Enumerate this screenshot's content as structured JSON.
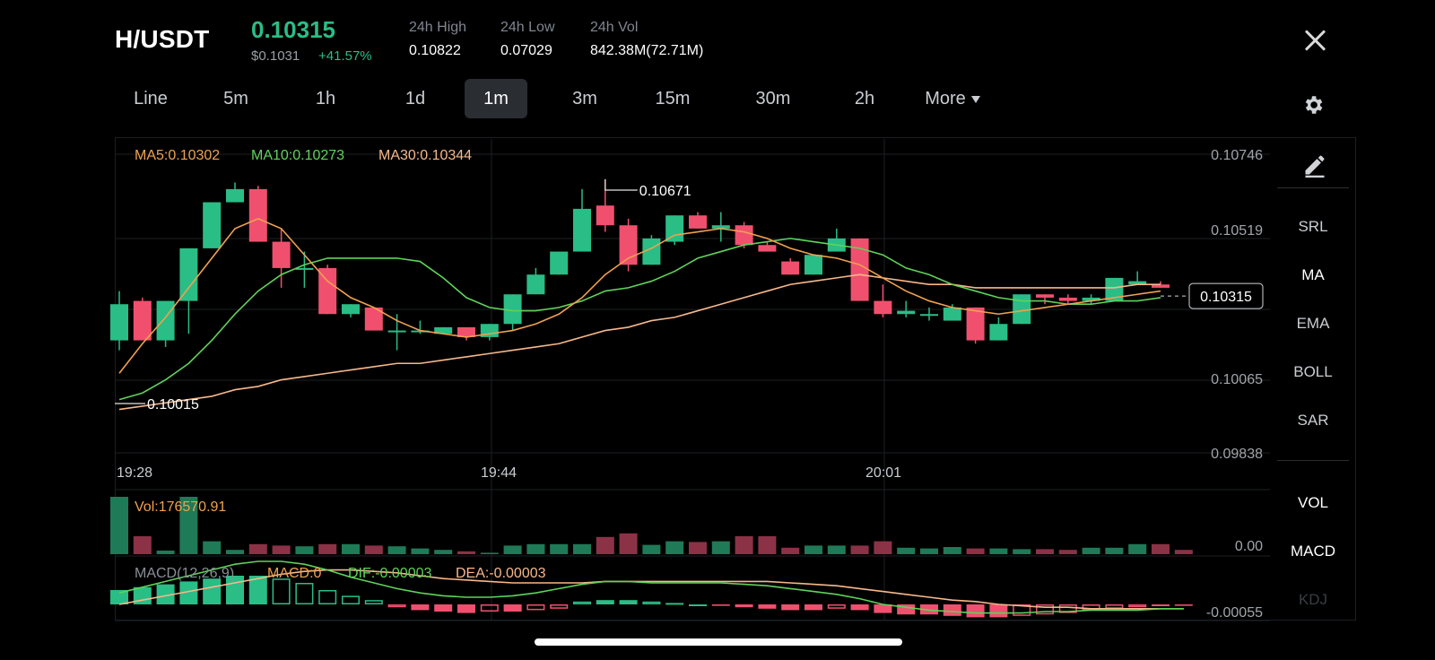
{
  "header": {
    "pair": "H/USDT",
    "price": "0.10315",
    "usd_price": "$0.1031",
    "change": "+41.57%",
    "stats": [
      {
        "label": "24h High",
        "value": "0.10822"
      },
      {
        "label": "24h Low",
        "value": "0.07029"
      },
      {
        "label": "24h Vol",
        "value": "842.38M(72.71M)"
      }
    ]
  },
  "tabs": [
    "Line",
    "5m",
    "1h",
    "1d",
    "1m",
    "3m",
    "15m",
    "30m",
    "2h",
    "More"
  ],
  "active_tab": "1m",
  "side_panel": [
    "SRL",
    "MA",
    "EMA",
    "BOLL",
    "SAR",
    "VOL",
    "MACD",
    "KDJ"
  ],
  "side_active": [
    "MA",
    "VOL",
    "MACD"
  ],
  "icons": {
    "close": "close-icon",
    "settings": "gear-icon",
    "draw": "pencil-icon",
    "more": "caret-down-icon"
  },
  "colors": {
    "up": "#2bbd86",
    "down": "#f0506e",
    "ma5": "#f0a150",
    "ma10": "#5fd35a",
    "ma30": "#f7b88a",
    "dif": "#5fd35a",
    "dea": "#f7b88a"
  },
  "chart_data": [
    {
      "type": "candlestick",
      "title": "",
      "legend": [
        {
          "label": "MA5:0.10302",
          "color": "#f0a150"
        },
        {
          "label": "MA10:0.10273",
          "color": "#5fd35a"
        },
        {
          "label": "MA30:0.10344",
          "color": "#f7b88a"
        }
      ],
      "y_ticks": [
        "0.10746",
        "0.10519",
        "0.10065",
        "0.09838"
      ],
      "ylim": [
        0.0977,
        0.1081
      ],
      "x_ticks": [
        {
          "label": "19:28",
          "index": 0
        },
        {
          "label": "19:44",
          "index": 16
        },
        {
          "label": "20:01",
          "index": 33
        }
      ],
      "current_price": "0.10315",
      "annotations": [
        {
          "label": "0.10671",
          "index": 21
        },
        {
          "label": "0.10015",
          "index": 0
        }
      ],
      "candles": [
        [
          0.1018,
          0.1029,
          0.1033,
          0.1015
        ],
        [
          0.103,
          0.1018,
          0.1031,
          0.1018
        ],
        [
          0.1018,
          0.103,
          0.103,
          0.1016
        ],
        [
          0.103,
          0.1046,
          0.1046,
          0.102
        ],
        [
          0.1046,
          0.106,
          0.106,
          0.1046
        ],
        [
          0.106,
          0.1064,
          0.1066,
          0.106
        ],
        [
          0.1064,
          0.1048,
          0.1065,
          0.1048
        ],
        [
          0.1048,
          0.104,
          0.1052,
          0.1034
        ],
        [
          0.104,
          0.104,
          0.1045,
          0.1034
        ],
        [
          0.104,
          0.1026,
          0.1041,
          0.1026
        ],
        [
          0.1026,
          0.1029,
          0.1029,
          0.1025
        ],
        [
          0.1028,
          0.1021,
          0.1028,
          0.1021
        ],
        [
          0.1021,
          0.1021,
          0.1026,
          0.1015
        ],
        [
          0.1021,
          0.1021,
          0.1024,
          0.102
        ],
        [
          0.102,
          0.1022,
          0.1022,
          0.102
        ],
        [
          0.1022,
          0.1019,
          0.1022,
          0.1018
        ],
        [
          0.1019,
          0.1023,
          0.1023,
          0.1018
        ],
        [
          0.1023,
          0.1032,
          0.1032,
          0.1021
        ],
        [
          0.1032,
          0.1038,
          0.104,
          0.1032
        ],
        [
          0.1038,
          0.1045,
          0.1045,
          0.1038
        ],
        [
          0.1045,
          0.1058,
          0.1064,
          0.1045
        ],
        [
          0.1059,
          0.1053,
          0.1067,
          0.1051
        ],
        [
          0.1053,
          0.1041,
          0.1055,
          0.1039
        ],
        [
          0.1041,
          0.1049,
          0.105,
          0.1041
        ],
        [
          0.1048,
          0.1056,
          0.1056,
          0.1047
        ],
        [
          0.1056,
          0.1052,
          0.1057,
          0.1052
        ],
        [
          0.1052,
          0.1053,
          0.1057,
          0.1048
        ],
        [
          0.1053,
          0.1047,
          0.1054,
          0.1046
        ],
        [
          0.1047,
          0.1045,
          0.1048,
          0.1045
        ],
        [
          0.1042,
          0.1038,
          0.1043,
          0.1038
        ],
        [
          0.1038,
          0.1044,
          0.1044,
          0.1038
        ],
        [
          0.1045,
          0.1049,
          0.1052,
          0.1045
        ],
        [
          0.1049,
          0.103,
          0.1049,
          0.103
        ],
        [
          0.103,
          0.1026,
          0.1035,
          0.1025
        ],
        [
          0.1026,
          0.1027,
          0.103,
          0.1025
        ],
        [
          0.1026,
          0.1026,
          0.1028,
          0.1024
        ],
        [
          0.1024,
          0.1028,
          0.1029,
          0.1024
        ],
        [
          0.1028,
          0.1018,
          0.1028,
          0.1017
        ],
        [
          0.1018,
          0.1023,
          0.1025,
          0.1018
        ],
        [
          0.1023,
          0.1032,
          0.1032,
          0.1023
        ],
        [
          0.1032,
          0.1031,
          0.1032,
          0.1029
        ],
        [
          0.1031,
          0.103,
          0.1032,
          0.1029
        ],
        [
          0.103,
          0.1031,
          0.1032,
          0.1029
        ],
        [
          0.103,
          0.1037,
          0.1037,
          0.103
        ],
        [
          0.1035,
          0.1036,
          0.1039,
          0.1035
        ],
        [
          0.1035,
          0.1034,
          0.1036,
          0.1034
        ]
      ],
      "ma5": [
        0.1008,
        0.1017,
        0.1025,
        0.1034,
        0.1043,
        0.1052,
        0.1055,
        0.1052,
        0.1044,
        0.1036,
        0.1031,
        0.1028,
        0.1024,
        0.1021,
        0.102,
        0.1019,
        0.102,
        0.1021,
        0.1023,
        0.1026,
        0.1031,
        0.1038,
        0.1043,
        0.1046,
        0.105,
        0.1051,
        0.1052,
        0.1051,
        0.1049,
        0.1046,
        0.1044,
        0.1043,
        0.1041,
        0.1037,
        0.1033,
        0.103,
        0.1028,
        0.1027,
        0.1026,
        0.1027,
        0.1028,
        0.1029,
        0.103,
        0.1031,
        0.1032,
        0.1033
      ],
      "ma10": [
        0.1,
        0.1002,
        0.1006,
        0.1011,
        0.1018,
        0.1026,
        0.1033,
        0.1038,
        0.1041,
        0.1043,
        0.1043,
        0.1043,
        0.1043,
        0.1042,
        0.1037,
        0.1031,
        0.1028,
        0.1027,
        0.1027,
        0.1028,
        0.103,
        0.1033,
        0.1034,
        0.1036,
        0.1039,
        0.1043,
        0.1045,
        0.1047,
        0.1048,
        0.1049,
        0.1048,
        0.1047,
        0.1046,
        0.1044,
        0.104,
        0.1038,
        0.1035,
        0.1033,
        0.1031,
        0.103,
        0.103,
        0.1029,
        0.1029,
        0.103,
        0.103,
        0.1031
      ],
      "ma30": [
        0.0997,
        0.0998,
        0.0999,
        0.1,
        0.1001,
        0.1003,
        0.1004,
        0.1006,
        0.1007,
        0.1008,
        0.1009,
        0.101,
        0.1011,
        0.1011,
        0.1012,
        0.1013,
        0.1014,
        0.1015,
        0.1016,
        0.1017,
        0.1019,
        0.1021,
        0.1022,
        0.1024,
        0.1025,
        0.1027,
        0.1029,
        0.1031,
        0.1033,
        0.1035,
        0.1036,
        0.1037,
        0.1038,
        0.1037,
        0.1036,
        0.1035,
        0.1035,
        0.1034,
        0.1034,
        0.1034,
        0.1034,
        0.1034,
        0.1034,
        0.1034,
        0.1035,
        0.1035
      ]
    },
    {
      "type": "bar",
      "title": "Vol:176570.91",
      "y_ticks": [
        "0.00"
      ],
      "values": [
        80,
        25,
        5,
        80,
        18,
        6,
        14,
        12,
        11,
        14,
        14,
        12,
        11,
        8,
        6,
        4,
        2,
        12,
        14,
        14,
        14,
        24,
        29,
        13,
        18,
        17,
        18,
        25,
        25,
        9,
        12,
        12,
        12,
        18,
        9,
        8,
        10,
        8,
        8,
        7,
        7,
        6,
        9,
        9,
        14,
        14,
        6
      ]
    },
    {
      "type": "bar",
      "title": "MACD(12,26,9)",
      "legend": [
        {
          "label": "MACD:0",
          "color": "#f0a150"
        },
        {
          "label": "DIF:-0.00003",
          "color": "#5fd35a"
        },
        {
          "label": "DEA:-0.00003",
          "color": "#f7b88a"
        }
      ],
      "y_ticks": [
        "-0.00055"
      ],
      "values": [
        0.0001,
        0.00012,
        0.00014,
        0.00016,
        0.00018,
        0.0002,
        0.0002,
        0.00018,
        0.00015,
        0.0001,
        6e-05,
        3e-05,
        -2e-05,
        -4e-05,
        -5e-05,
        -6e-05,
        -5e-05,
        -5e-05,
        -4e-05,
        -3e-05,
        2e-05,
        3e-05,
        3e-05,
        2e-05,
        1e-05,
        0.0,
        -1e-05,
        -2e-05,
        -3e-05,
        -4e-05,
        -4e-05,
        -3e-05,
        -4e-05,
        -6e-05,
        -7e-05,
        -7e-05,
        -8e-05,
        -9e-05,
        -9e-05,
        -8e-05,
        -7e-05,
        -6e-05,
        -4e-05,
        -3e-05,
        -2e-05,
        -1e-05,
        -1e-05
      ],
      "dif": [
        8e-05,
        0.00012,
        0.00016,
        0.0002,
        0.00024,
        0.00028,
        0.0003,
        0.0003,
        0.00028,
        0.00024,
        0.00019,
        0.00015,
        0.00011,
        8e-05,
        6e-05,
        5e-05,
        5e-05,
        6e-05,
        8e-05,
        0.00011,
        0.00014,
        0.00016,
        0.00016,
        0.00015,
        0.00015,
        0.00015,
        0.00015,
        0.00014,
        0.00013,
        0.00011,
        9e-05,
        7e-05,
        4e-05,
        0.0,
        -2e-05,
        -4e-05,
        -5e-05,
        -6e-05,
        -6e-05,
        -6e-05,
        -5e-05,
        -5e-05,
        -4e-05,
        -4e-05,
        -4e-05,
        -3e-05,
        -3e-05
      ],
      "dea": [
        0.0,
        3e-05,
        6e-05,
        9e-05,
        0.00012,
        0.00015,
        0.00018,
        0.00021,
        0.00023,
        0.00024,
        0.00024,
        0.00023,
        0.00022,
        0.0002,
        0.00018,
        0.00017,
        0.00016,
        0.00015,
        0.00015,
        0.00015,
        0.00015,
        0.00016,
        0.00016,
        0.00016,
        0.00016,
        0.00016,
        0.00016,
        0.00016,
        0.00016,
        0.00015,
        0.00014,
        0.00013,
        0.00011,
        9e-05,
        7e-05,
        5e-05,
        3e-05,
        2e-05,
        0.0,
        -1e-05,
        -2e-05,
        -2e-05,
        -3e-05,
        -3e-05,
        -3e-05,
        -3e-05,
        -3e-05
      ]
    }
  ]
}
